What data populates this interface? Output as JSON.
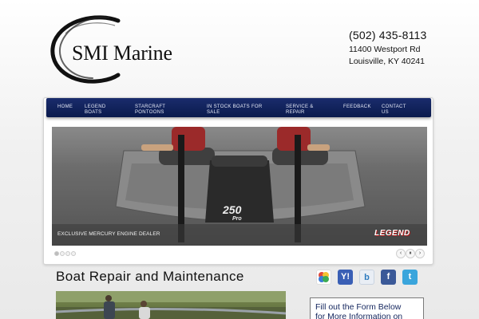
{
  "brand": {
    "name": "SMI Marine"
  },
  "contact": {
    "phone": "(502) 435-8113",
    "street": "11400 Westport Rd",
    "city": "Louisville, KY 40241"
  },
  "nav": {
    "items": [
      {
        "line1": "HOME",
        "line2": ""
      },
      {
        "line1": "LEGEND",
        "line2": "BOATS"
      },
      {
        "line1": "STARCRAFT",
        "line2": "PONTOONS"
      },
      {
        "line1": "IN STOCK BOATS FOR",
        "line2": "SALE"
      },
      {
        "line1": "SERVICE &",
        "line2": "REPAIR"
      },
      {
        "line1": "FEEDBACK",
        "line2": ""
      },
      {
        "line1": "CONTACT",
        "line2": "US"
      }
    ]
  },
  "slider": {
    "caption": "EXCLUSIVE MERCURY ENGINE DEALER",
    "engine_number": "250",
    "engine_model": "Pro",
    "badge": "LEGEND",
    "dot_count": 4,
    "active_dot": 0,
    "controls": {
      "prev": "‹",
      "pause": "⏸",
      "next": "›"
    }
  },
  "main": {
    "title": "Boat Repair and Maintenance"
  },
  "social": [
    {
      "name": "google-icon",
      "glyph": "g",
      "color": "#3b7bd8"
    },
    {
      "name": "yahoo-icon",
      "glyph": "Y!",
      "color": "#3a5fb5"
    },
    {
      "name": "bing-icon",
      "glyph": "b",
      "color": "#2d7bbf"
    },
    {
      "name": "facebook-icon",
      "glyph": "f",
      "color": "#3b5998"
    },
    {
      "name": "twitter-icon",
      "glyph": "t",
      "color": "#3aa5dc"
    }
  ],
  "sidebar": {
    "form_line1": "Fill out the Form Below",
    "form_line2": "for More Information on"
  },
  "colors": {
    "nav_bg": "#0f1f57",
    "nav_text": "#e6eaf7",
    "form_text": "#14265e"
  }
}
